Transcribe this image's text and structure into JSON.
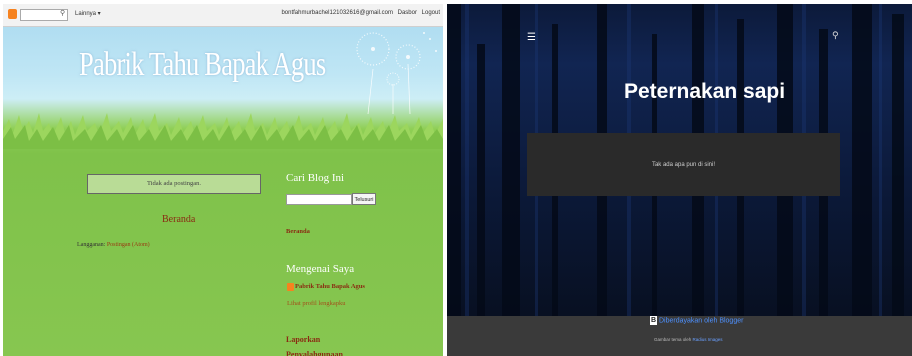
{
  "left_blog": {
    "navbar": {
      "more_label": "Lainnya ▾",
      "user_email": "bontfahmurbachel121032616@gmail.com",
      "dasbor_label": "Dasbor",
      "logout_label": "Logout"
    },
    "title": "Pabrik Tahu Bapak Agus",
    "no_posts_text": "Tidak ada postingan.",
    "home_link": "Beranda",
    "subscribe": {
      "prefix": "Langganan: ",
      "link": "Postingan (Atom)"
    },
    "sidebar": {
      "search_title": "Cari Blog Ini",
      "search_button": "Telusuri",
      "home_link": "Beranda",
      "about_title": "Mengenai Saya",
      "profile_name": "Pabrik Tahu Bapak Agus",
      "view_profile": "Lihat profil lengkapku",
      "report_title_line1": "Laporkan",
      "report_title_line2": "Penyalahgunaan"
    },
    "colors": {
      "accent_link": "#8a2b12",
      "blogger_orange": "#f6821f"
    }
  },
  "right_blog": {
    "title": "Peternakan sapi",
    "empty_text": "Tak ada apa pun di sini!",
    "powered_by": "Diberdayakan oleh Blogger",
    "theme_prefix": "Gambar tema oleh ",
    "theme_author": "Radius Images",
    "menu_icon": "hamburger-icon",
    "search_icon": "search-icon",
    "colors": {
      "link_blue": "#4d90fe",
      "panel": "#2a2a2a",
      "footer": "#3a3a3a"
    }
  }
}
